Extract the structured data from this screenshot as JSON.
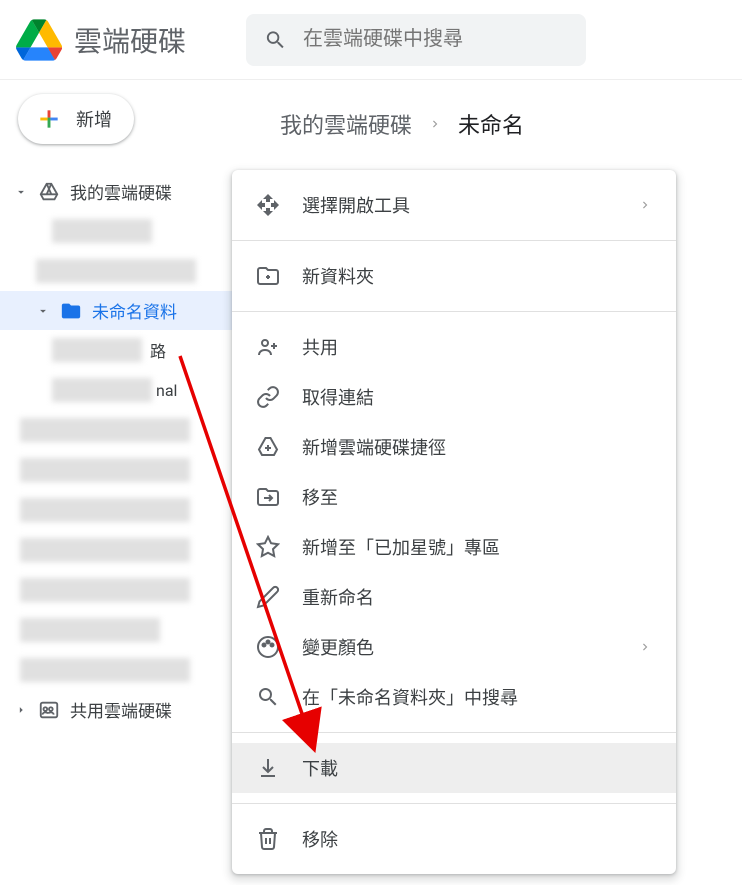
{
  "header": {
    "title": "雲端硬碟",
    "search_placeholder": "在雲端硬碟中搜尋"
  },
  "sidebar": {
    "new_button": "新增",
    "my_drive": "我的雲端硬碟",
    "active_folder": "未命名資料",
    "row_suffix_1": "路",
    "row_suffix_2": "nal",
    "shared": "共用雲端硬碟"
  },
  "breadcrumb": {
    "root": "我的雲端硬碟",
    "current": "未命名"
  },
  "menu": {
    "open_with": "選擇開啟工具",
    "new_folder": "新資料夾",
    "share": "共用",
    "get_link": "取得連結",
    "add_shortcut": "新增雲端硬碟捷徑",
    "move_to": "移至",
    "add_star": "新增至「已加星號」專區",
    "rename": "重新命名",
    "change_color": "變更顏色",
    "search_in": "在「未命名資料夾」中搜尋",
    "download": "下載",
    "remove": "移除"
  }
}
